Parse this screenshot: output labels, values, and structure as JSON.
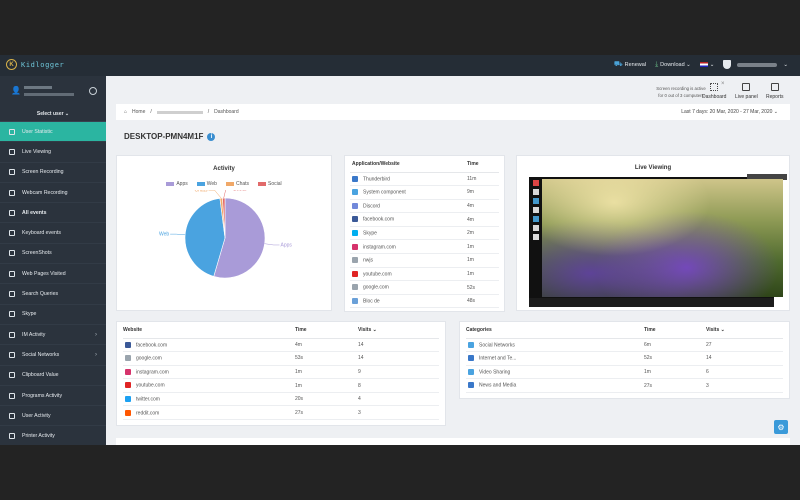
{
  "app": {
    "logo_text": "Kidlogger"
  },
  "topbar": {
    "renewal": "Renewal",
    "download": "Download ⌄",
    "flag_caret": "⌄",
    "account_caret": "⌄"
  },
  "sidebar": {
    "select_user": "Select user ⌄",
    "items": [
      {
        "label": "User Statistic",
        "icon": "chart-icon",
        "active": true
      },
      {
        "label": "Live Viewing",
        "icon": "monitor-icon"
      },
      {
        "label": "Screen Recording",
        "icon": "play-icon"
      },
      {
        "label": "Webcam Recording",
        "icon": "camera-icon"
      },
      {
        "label": "All events",
        "icon": "list-icon",
        "section": true
      },
      {
        "label": "Keyboard events",
        "icon": "keyboard-icon"
      },
      {
        "label": "ScreenShots",
        "icon": "image-icon"
      },
      {
        "label": "Web Pages Visited",
        "icon": "globe-icon"
      },
      {
        "label": "Search Queries",
        "icon": "search-icon"
      },
      {
        "label": "Skype",
        "icon": "skype-icon"
      },
      {
        "label": "IM Activity",
        "icon": "chat-icon",
        "caret": true
      },
      {
        "label": "Social Networks",
        "icon": "social-icon",
        "caret": true
      },
      {
        "label": "Clipboard Value",
        "icon": "clipboard-icon"
      },
      {
        "label": "Programs Activity",
        "icon": "apps-icon"
      },
      {
        "label": "User Activity",
        "icon": "user-icon"
      },
      {
        "label": "Printer Activity",
        "icon": "printer-icon"
      }
    ]
  },
  "notice": {
    "line1": "Screen recording is active",
    "line2": "for 0 out of 3 computers"
  },
  "quick_links": {
    "dashboard": "Dashboard",
    "live_panel": "Live panel",
    "reports": "Reports"
  },
  "breadcrumb": {
    "home": "Home",
    "sep": "/",
    "current": "Dashboard"
  },
  "date_range": "Last 7 days: 20 Mar, 2020 - 27 Mar, 2020 ⌄",
  "computer": {
    "name": "DESKTOP-PMN4M1F",
    "info": "i"
  },
  "activity": {
    "title": "Activity"
  },
  "chart_data": {
    "type": "pie",
    "title": "Activity",
    "legend_position": "top",
    "slices": [
      {
        "label": "Apps",
        "value": 54,
        "color": "#a99bd8"
      },
      {
        "label": "Web",
        "value": 43,
        "color": "#4aa3e0"
      },
      {
        "label": "Chats",
        "value": 1,
        "color": "#f0a868"
      },
      {
        "label": "Social",
        "value": 1,
        "color": "#e16a6a"
      }
    ]
  },
  "app_table": {
    "col_app": "Application/Website",
    "col_time": "Time",
    "rows": [
      {
        "name": "Thunderbird",
        "time": "11m",
        "color": "#3a78c9"
      },
      {
        "name": "System component",
        "time": "9m",
        "color": "#4aa3e0"
      },
      {
        "name": "Discord",
        "time": "4m",
        "color": "#7289da"
      },
      {
        "name": "facebook.com",
        "time": "4m",
        "color": "#3b5998"
      },
      {
        "name": "Skype",
        "time": "2m",
        "color": "#00aff0"
      },
      {
        "name": "instagram.com",
        "time": "1m",
        "color": "#d6336c"
      },
      {
        "name": "nwjs",
        "time": "1m",
        "color": "#9aa4ad"
      },
      {
        "name": "youtube.com",
        "time": "1m",
        "color": "#e02424"
      },
      {
        "name": "google.com",
        "time": "52s",
        "color": "#9aa4ad"
      },
      {
        "name": "Bloc de",
        "time": "48s",
        "color": "#6aa0d8"
      }
    ]
  },
  "live_viewing": {
    "title": "Live Viewing"
  },
  "websites": {
    "col_site": "Website",
    "col_time": "Time",
    "col_visits": "Visits ⌄",
    "rows": [
      {
        "site": "facebook.com",
        "time": "4m",
        "visits": "14",
        "color": "#3b5998"
      },
      {
        "site": "google.com",
        "time": "53s",
        "visits": "14",
        "color": "#9aa4ad"
      },
      {
        "site": "instagram.com",
        "time": "1m",
        "visits": "9",
        "color": "#d6336c"
      },
      {
        "site": "youtube.com",
        "time": "1m",
        "visits": "8",
        "color": "#e02424"
      },
      {
        "site": "twitter.com",
        "time": "20s",
        "visits": "4",
        "color": "#1da1f2"
      },
      {
        "site": "reddit.com",
        "time": "27s",
        "visits": "3",
        "color": "#ff5700"
      }
    ]
  },
  "categories": {
    "col_cat": "Categories",
    "col_time": "Time",
    "col_visits": "Visits ⌄",
    "rows": [
      {
        "name": "Social Networks",
        "time": "6m",
        "visits": "27",
        "color": "#4aa3e0"
      },
      {
        "name": "Internet and Te...",
        "time": "52s",
        "visits": "14",
        "color": "#3a78c9"
      },
      {
        "name": "Video Sharing",
        "time": "1m",
        "visits": "6",
        "color": "#4aa3e0"
      },
      {
        "name": "News and Media",
        "time": "27s",
        "visits": "3",
        "color": "#3a78c9"
      }
    ]
  }
}
